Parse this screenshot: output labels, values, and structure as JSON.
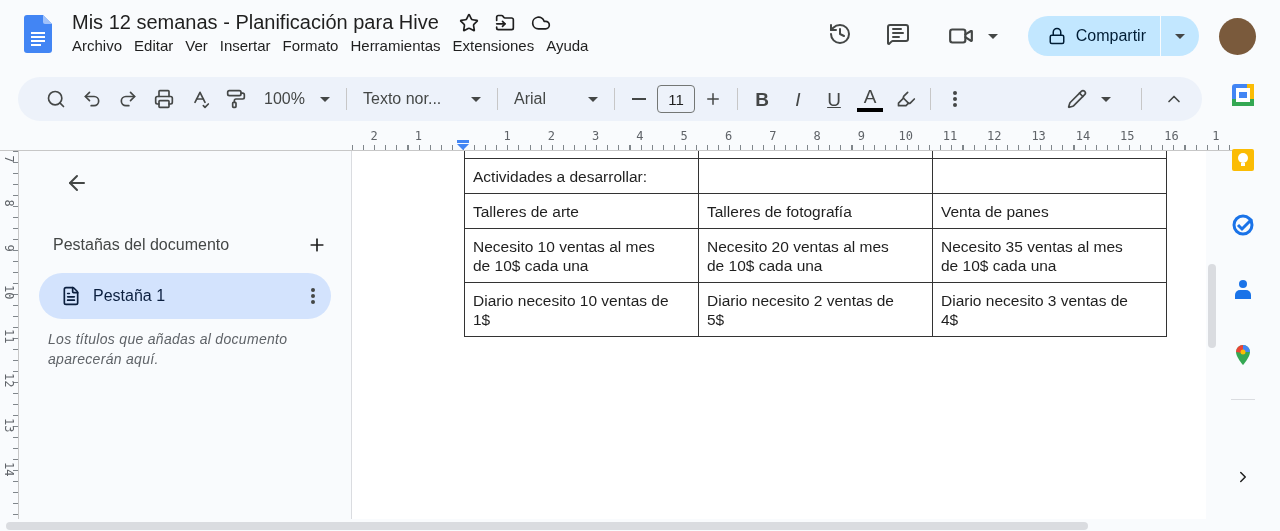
{
  "header": {
    "title": "Mis 12 semanas - Planificación para Hive",
    "menu": [
      "Archivo",
      "Editar",
      "Ver",
      "Insertar",
      "Formato",
      "Herramientas",
      "Extensiones",
      "Ayuda"
    ],
    "share_label": "Compartir"
  },
  "toolbar": {
    "zoom": "100%",
    "style": "Texto nor...",
    "font": "Arial",
    "font_size": "11",
    "format_buttons": [
      {
        "kind": "bold",
        "label": "B"
      },
      {
        "kind": "italic",
        "label": "I"
      },
      {
        "kind": "underline",
        "label": "U"
      },
      {
        "kind": "color",
        "label": "A"
      }
    ]
  },
  "ruler": {
    "horizontal": [
      "2",
      "1",
      "1",
      "2",
      "3",
      "4",
      "5",
      "6",
      "7",
      "8",
      "9",
      "10",
      "11",
      "12",
      "13",
      "14",
      "15",
      "16",
      "1"
    ],
    "vertical": [
      "7",
      "8",
      "9",
      "10",
      "11",
      "12",
      "13",
      "14"
    ]
  },
  "sidebar": {
    "heading": "Pestañas del documento",
    "tabs": [
      {
        "label": "Pestaña 1",
        "selected": true
      }
    ],
    "hint": "Los títulos que añadas al documento aparecerán aquí."
  },
  "table": {
    "rows": [
      {
        "cells": [
          "Actividades a desarrollar:"
        ]
      },
      {
        "cells": [
          "Talleres de arte",
          "Talleres de fotografía",
          "Venta de panes"
        ]
      },
      {
        "cells": [
          "Necesito 10 ventas al mes de 10$ cada una",
          "Necesito 20 ventas al mes de 10$ cada una",
          "Necesito 35 ventas al mes de 10$ cada una"
        ]
      },
      {
        "cells": [
          "Diario necesito 10 ventas de 1$",
          "Diario necesito 2 ventas de 5$",
          "Diario necesito 3 ventas de 4$"
        ]
      }
    ]
  }
}
